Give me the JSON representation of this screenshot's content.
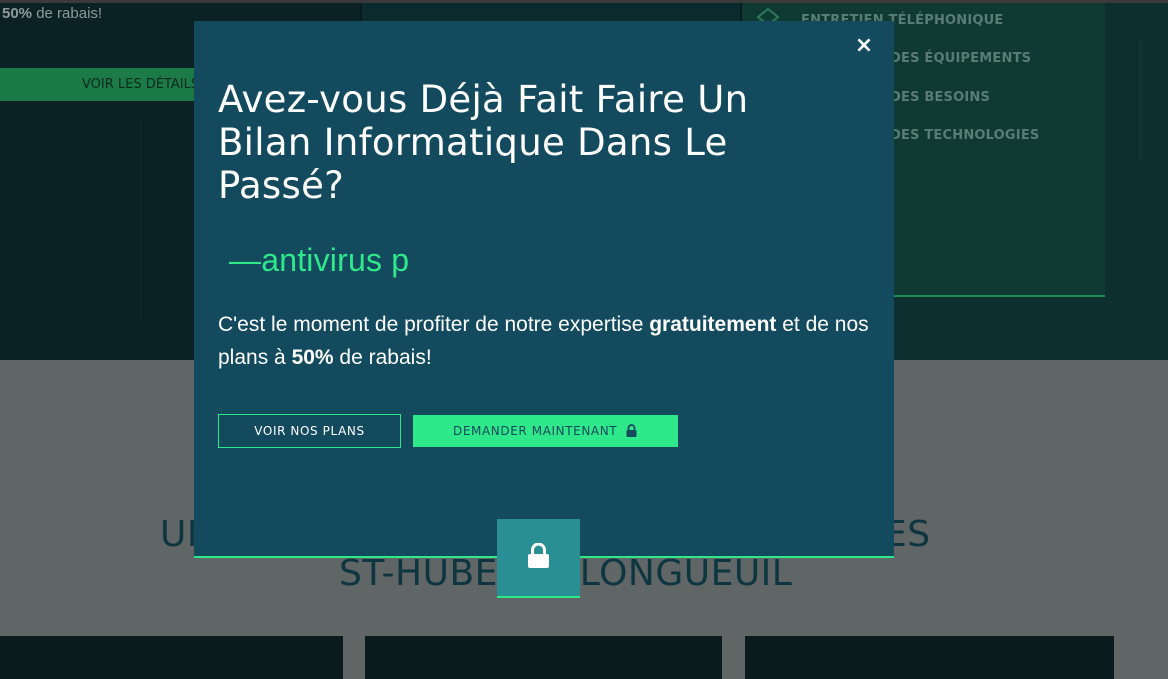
{
  "background": {
    "discount_strong": "50%",
    "discount_rest": " de rabais!",
    "details_button": "VOIR LES DÉTAILS",
    "service_items": [
      "ENTRETIEN TÉLÉPHONIQUE",
      "DES ÉQUIPEMENTS",
      "DES BESOINS",
      "DES TECHNOLOGIES"
    ],
    "heading_line1_left": "UN",
    "heading_line1_right": "ES",
    "heading_line2": "ST-HUBERT / LONGUEUIL"
  },
  "modal": {
    "close_label": "×",
    "title": "Avez-vous Déjà Fait Faire Un Bilan Informatique Dans Le Passé?",
    "typing_dash": "—",
    "typing_text": "antivirus p",
    "text_part1": "C'est le moment de profiter de notre expertise ",
    "text_bold1": "gratuitement",
    "text_part2": " et de nos plans à ",
    "text_bold2": "50%",
    "text_part3": " de rabais!",
    "btn_plans": "VOIR NOS PLANS",
    "btn_request": "DEMANDER MAINTENANT",
    "btn_request_icon": "lock-icon",
    "tab_icon": "lock-icon"
  },
  "colors": {
    "modal_bg": "#134a5d",
    "accent": "#2ee88a",
    "tab_bg": "#2a8f94"
  }
}
